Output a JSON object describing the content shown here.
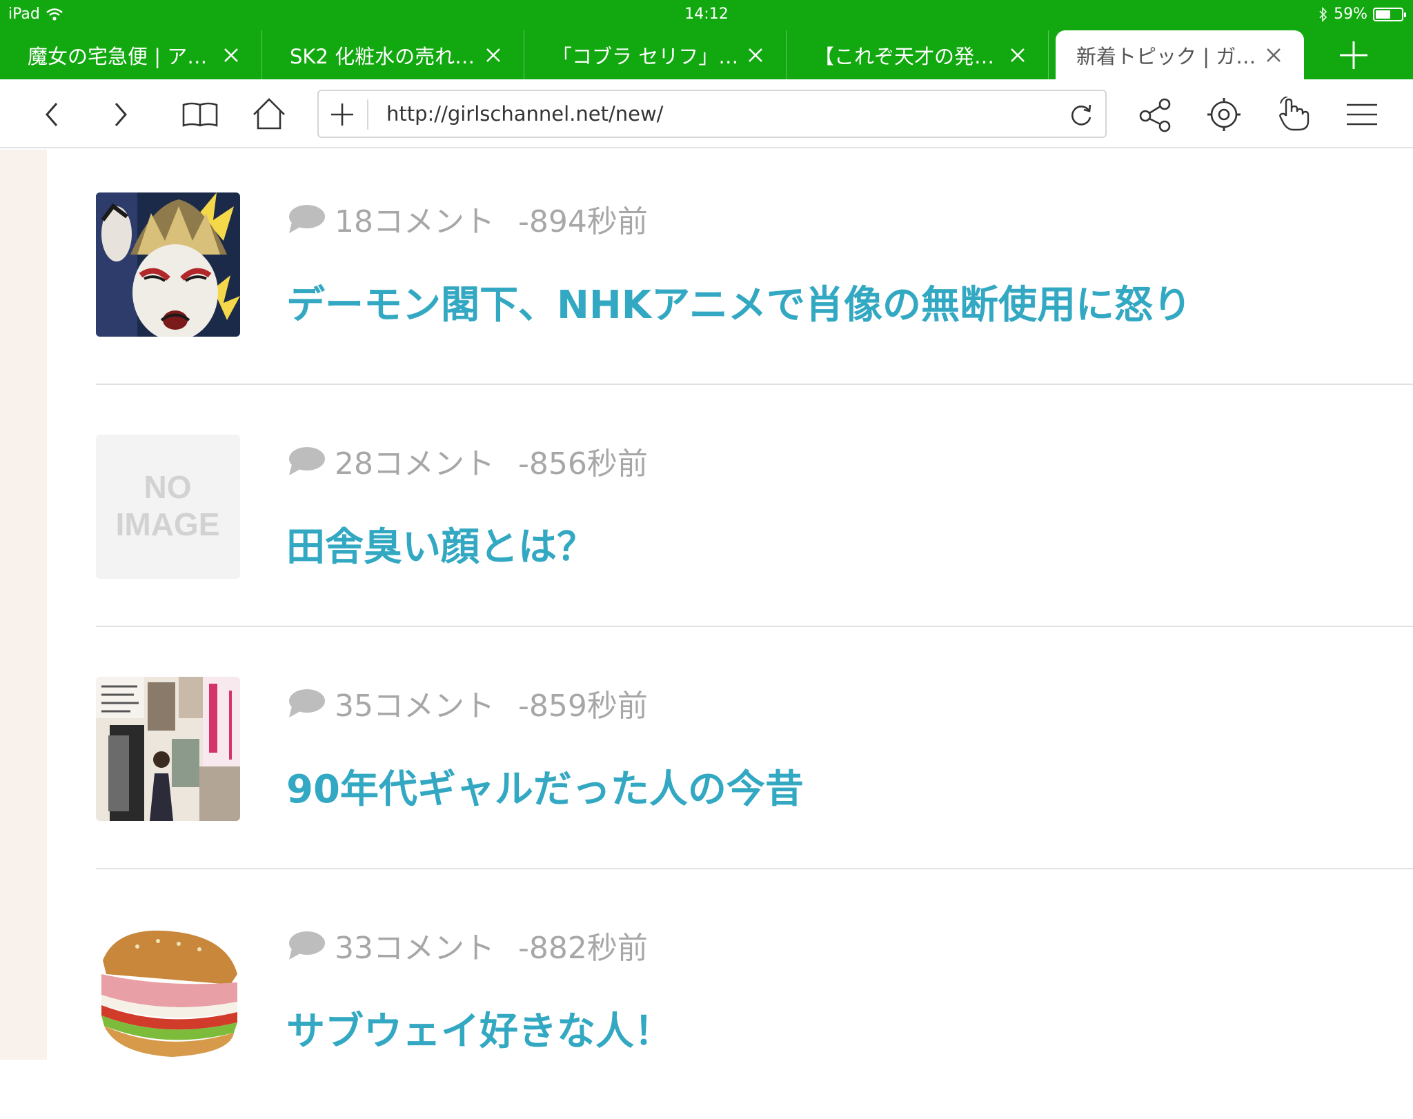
{
  "status_bar": {
    "device": "iPad",
    "time": "14:12",
    "battery_text": "59%",
    "battery_level": 0.59
  },
  "tabs": [
    {
      "title": "魔女の宅急便 | ア…",
      "active": false
    },
    {
      "title": "SK2 化粧水の売れ…",
      "active": false
    },
    {
      "title": "「コブラ セリフ」…",
      "active": false
    },
    {
      "title": "【これぞ天才の発…",
      "active": false
    },
    {
      "title": "新着トピック | ガ…",
      "active": true
    }
  ],
  "address_bar": {
    "url": "http://girlschannel.net/new/"
  },
  "colors": {
    "chrome_green": "#12a80f",
    "link_blue": "#33a8c2",
    "meta_gray": "#a7a7a7",
    "side_strip": "#f8f1ec"
  },
  "icons": {
    "back": "chevron-left-icon",
    "forward": "chevron-right-icon",
    "bookmarks": "book-icon",
    "home": "home-icon",
    "add": "plus-icon",
    "reload": "reload-icon",
    "share": "share-icon",
    "settings": "gear-icon",
    "gesture": "hand-pointer-icon",
    "menu": "hamburger-menu-icon",
    "comment": "speech-bubble-icon"
  },
  "topics": [
    {
      "comments": "18コメント",
      "time": "-894秒前",
      "title": "デーモン閣下、NHKアニメで肖像の無断使用に怒り",
      "thumb": "photo"
    },
    {
      "comments": "28コメント",
      "time": "-856秒前",
      "title": "田舎臭い顔とは？",
      "thumb": "no-image",
      "thumb_text": [
        "NO",
        "IMAGE"
      ]
    },
    {
      "comments": "35コメント",
      "time": "-859秒前",
      "title": "90年代ギャルだった人の今昔",
      "thumb": "photo"
    },
    {
      "comments": "33コメント",
      "time": "-882秒前",
      "title": "サブウェイ好きな人！",
      "thumb": "photo"
    }
  ]
}
